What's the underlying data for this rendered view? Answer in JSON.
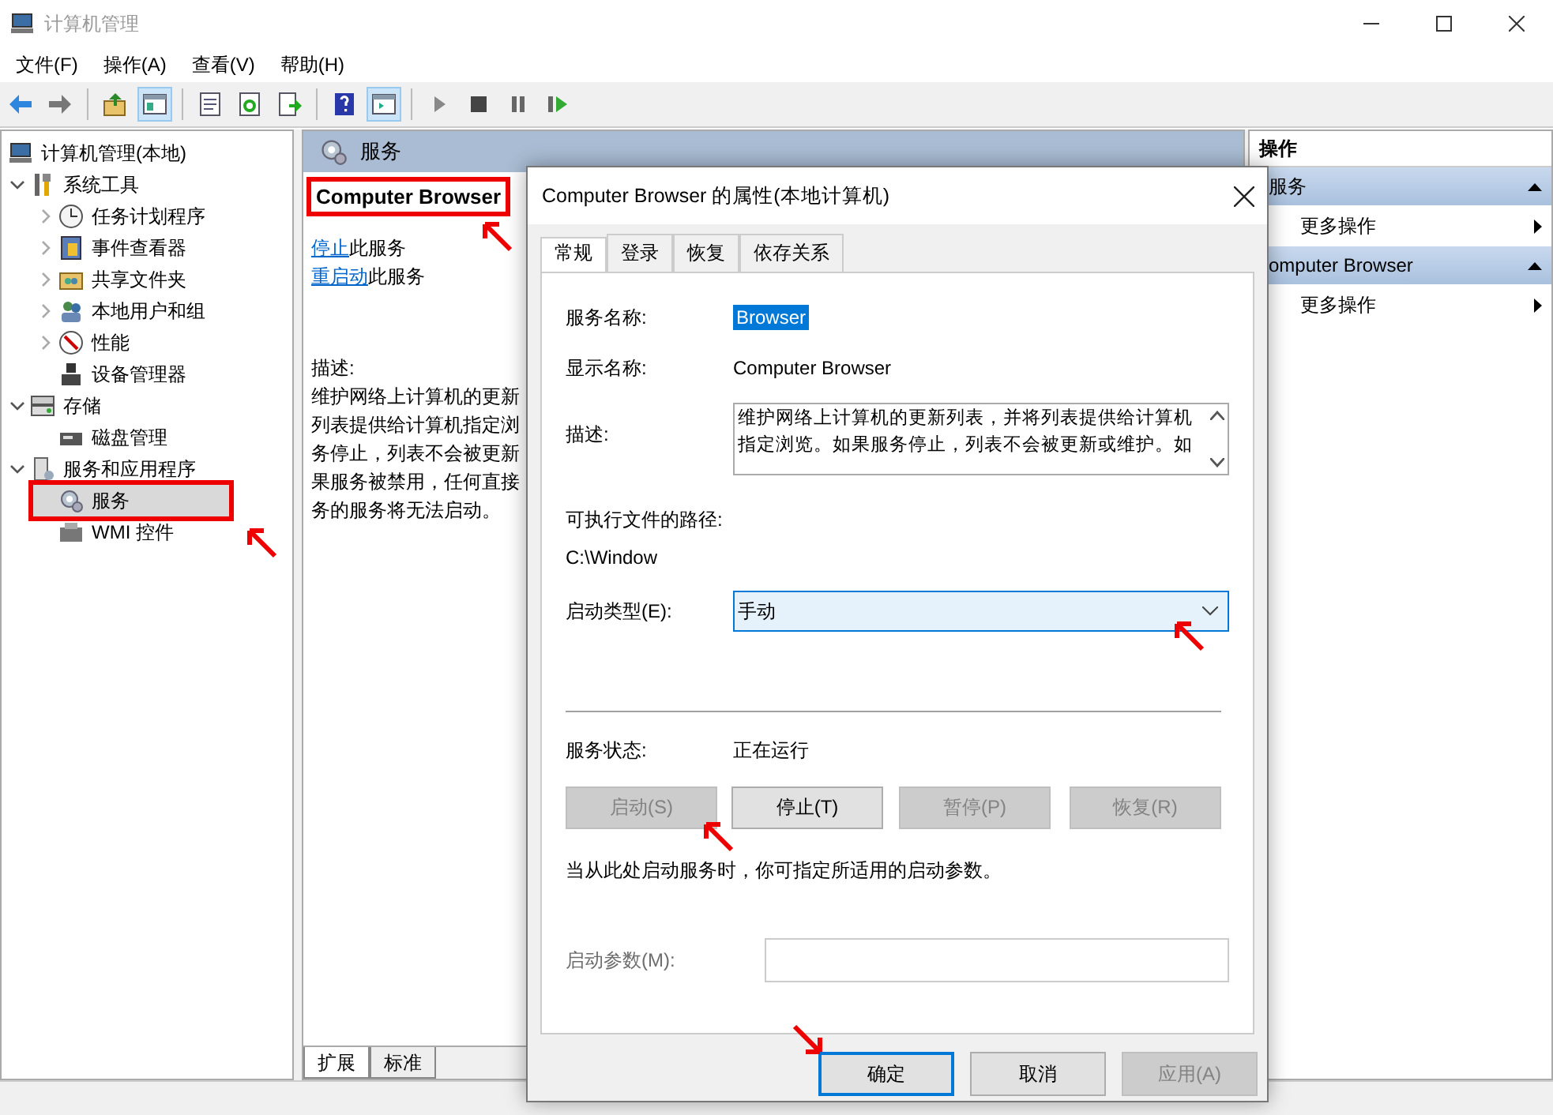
{
  "window": {
    "title": "计算机管理"
  },
  "menu": [
    "文件(F)",
    "操作(A)",
    "查看(V)",
    "帮助(H)"
  ],
  "toolbar": [
    {
      "kind": "back",
      "pressed": false
    },
    {
      "kind": "forward",
      "pressed": false
    },
    {
      "kind": "sep"
    },
    {
      "kind": "up",
      "pressed": false
    },
    {
      "kind": "tree",
      "pressed": true
    },
    {
      "kind": "sep"
    },
    {
      "kind": "props",
      "pressed": false
    },
    {
      "kind": "refresh",
      "pressed": false
    },
    {
      "kind": "export",
      "pressed": false
    },
    {
      "kind": "sep"
    },
    {
      "kind": "help",
      "pressed": false
    },
    {
      "kind": "pane",
      "pressed": true
    },
    {
      "kind": "sep"
    },
    {
      "kind": "play",
      "pressed": false
    },
    {
      "kind": "stop",
      "pressed": false
    },
    {
      "kind": "pause",
      "pressed": false
    },
    {
      "kind": "resume",
      "pressed": false
    }
  ],
  "tree": [
    {
      "label": "计算机管理(本地)",
      "selected": false,
      "highlighted": false,
      "children": [
        {
          "label": "系统工具",
          "expanded": true,
          "selected": false,
          "highlighted": false,
          "children": [
            {
              "label": "任务计划程序",
              "expanded": false,
              "selected": false,
              "highlighted": false
            },
            {
              "label": "事件查看器",
              "expanded": false,
              "selected": false,
              "highlighted": false
            },
            {
              "label": "共享文件夹",
              "expanded": false,
              "selected": false,
              "highlighted": false
            },
            {
              "label": "本地用户和组",
              "expanded": false,
              "selected": false,
              "highlighted": false
            },
            {
              "label": "性能",
              "expanded": false,
              "selected": false,
              "highlighted": false
            },
            {
              "label": "设备管理器",
              "selected": false,
              "highlighted": false
            }
          ]
        },
        {
          "label": "存储",
          "expanded": true,
          "selected": false,
          "highlighted": false,
          "children": [
            {
              "label": "磁盘管理",
              "selected": false,
              "highlighted": false
            }
          ]
        },
        {
          "label": "服务和应用程序",
          "expanded": true,
          "selected": false,
          "highlighted": false,
          "children": [
            {
              "label": "服务",
              "selected": true,
              "highlighted": true
            },
            {
              "label": "WMI 控件",
              "selected": false,
              "highlighted": false
            }
          ]
        }
      ]
    }
  ],
  "services_pane": {
    "title": "服务",
    "service_name": "Computer Browser",
    "name_highlighted": true,
    "actions": [
      {
        "link": "停止",
        "text": "此服务"
      },
      {
        "link": "重启动",
        "text": "此服务"
      }
    ],
    "description_label": "描述:",
    "description_lines": [
      "维护网络上计算机的更新",
      "列表提供给计算机指定浏",
      "务停止，列表不会被更新",
      "果服务被禁用，任何直接",
      "务的服务将无法启动。"
    ],
    "bottom_tabs": [
      {
        "label": "扩展",
        "selected": true
      },
      {
        "label": "标准",
        "selected": false
      }
    ]
  },
  "actions_pane": {
    "title": "操作",
    "sections": [
      {
        "title": "服务",
        "item": "更多操作"
      },
      {
        "title": "omputer Browser",
        "item": "更多操作"
      }
    ]
  },
  "dialog": {
    "title": "Computer Browser 的属性(本地计算机)",
    "tabs": [
      {
        "label": "常规",
        "selected": true
      },
      {
        "label": "登录",
        "selected": false
      },
      {
        "label": "恢复",
        "selected": false
      },
      {
        "label": "依存关系",
        "selected": false
      }
    ],
    "service_name_label": "服务名称:",
    "service_name": "Browser",
    "display_name_label": "显示名称:",
    "display_name": "Computer Browser",
    "description_label": "描述:",
    "description_lines": [
      "维护网络上计算机的更新列表，并将列表提供给计算机",
      "指定浏览。如果服务停止，列表不会被更新或维护。如"
    ],
    "path_label": "可执行文件的路径:",
    "path": "C:\\Window",
    "startup_type_label": "启动类型(E):",
    "startup_type": "手动",
    "status_label": "服务状态:",
    "status": "正在运行",
    "service_buttons": [
      {
        "label": "启动(S)",
        "disabled": true
      },
      {
        "label": "停止(T)",
        "disabled": false
      },
      {
        "label": "暂停(P)",
        "disabled": true
      },
      {
        "label": "恢复(R)",
        "disabled": true
      }
    ],
    "note": "当从此处启动服务时，你可指定所适用的启动参数。",
    "params_label": "启动参数(M):",
    "params_disabled": true,
    "buttons": [
      {
        "label": "确定",
        "default": true,
        "disabled": false
      },
      {
        "label": "取消",
        "default": false,
        "disabled": false
      },
      {
        "label": "应用(A)",
        "default": false,
        "disabled": true
      }
    ]
  }
}
